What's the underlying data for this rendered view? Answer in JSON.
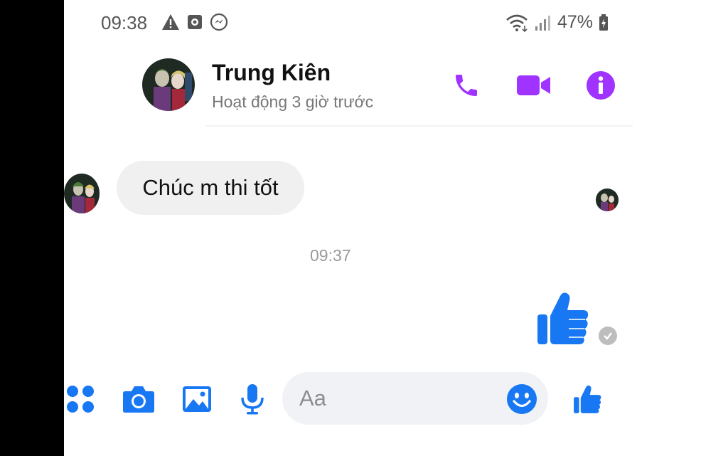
{
  "status_bar": {
    "time": "09:38",
    "battery": "47%",
    "icons": [
      "warning-icon",
      "media-icon",
      "messenger-icon",
      "wifi-icon",
      "signal-icon",
      "battery-icon"
    ]
  },
  "header": {
    "name": "Trung Kiên",
    "status": "Hoạt động 3 giờ trước",
    "accent_color": "#a033ff",
    "actions": [
      "phone-icon",
      "video-call-icon",
      "info-icon"
    ]
  },
  "conversation": {
    "received_message": "Chúc m thi tốt",
    "timestamp": "09:37",
    "sent_message": "thumbs-up-icon",
    "sent_status": "seen"
  },
  "composer": {
    "placeholder": "Aa",
    "accent_color": "#1877f2",
    "tools": [
      "menu-dots-icon",
      "camera-icon",
      "gallery-icon",
      "microphone-icon"
    ],
    "emoji_icon": "emoji-icon",
    "like_icon": "thumbs-up-icon"
  }
}
